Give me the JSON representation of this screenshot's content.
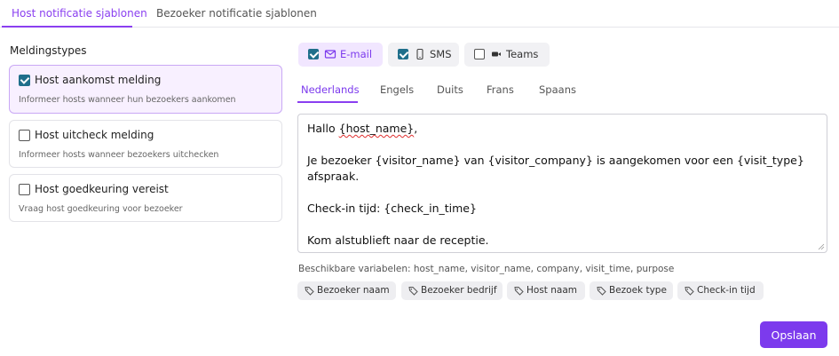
{
  "top_tabs": [
    {
      "label": "Host notificatie sjablonen",
      "active": true
    },
    {
      "label": "Bezoeker notificatie sjablonen",
      "active": false
    }
  ],
  "sidebar": {
    "title": "Meldingstypes",
    "items": [
      {
        "title": "Host aankomst melding",
        "description": "Informeer hosts wanneer hun bezoekers aankomen",
        "checked": true,
        "selected": true
      },
      {
        "title": "Host uitcheck melding",
        "description": "Informeer hosts wanneer bezoekers uitchecken",
        "checked": false,
        "selected": false
      },
      {
        "title": "Host goedkeuring vereist",
        "description": "Vraag host goedkeuring voor bezoeker",
        "checked": false,
        "selected": false
      }
    ]
  },
  "channels": [
    {
      "label": "E-mail",
      "icon": "mail-icon",
      "checked": true
    },
    {
      "label": "SMS",
      "icon": "phone-icon",
      "checked": true
    },
    {
      "label": "Teams",
      "icon": "video-icon",
      "checked": false
    }
  ],
  "languages": [
    {
      "label": "Nederlands",
      "active": true
    },
    {
      "label": "Engels",
      "active": false
    },
    {
      "label": "Duits",
      "active": false
    },
    {
      "label": "Frans",
      "active": false
    },
    {
      "label": "Spaans",
      "active": false
    }
  ],
  "editor": {
    "greeting_prefix": "Hallo ",
    "greeting_var": "{host_name}",
    "greeting_suffix": ",",
    "line2": "Je bezoeker {visitor_name} van {visitor_company} is aangekomen voor een {visit_type}",
    "line3": "afspraak.",
    "line4": "Check-in tijd: {check_in_time}",
    "line5": "Kom alstublieft naar de receptie."
  },
  "variables_text": "Beschikbare variabelen: host_name, visitor_name, company, visit_time, purpose",
  "chips": [
    "Bezoeker naam",
    "Bezoeker bedrijf",
    "Host naam",
    "Bezoek type",
    "Check-in tijd"
  ],
  "save_label": "Opslaan",
  "colors": {
    "accent": "#7c3aed",
    "checkbox": "#1f6f8b",
    "selected_bg": "#f8f0ff"
  }
}
